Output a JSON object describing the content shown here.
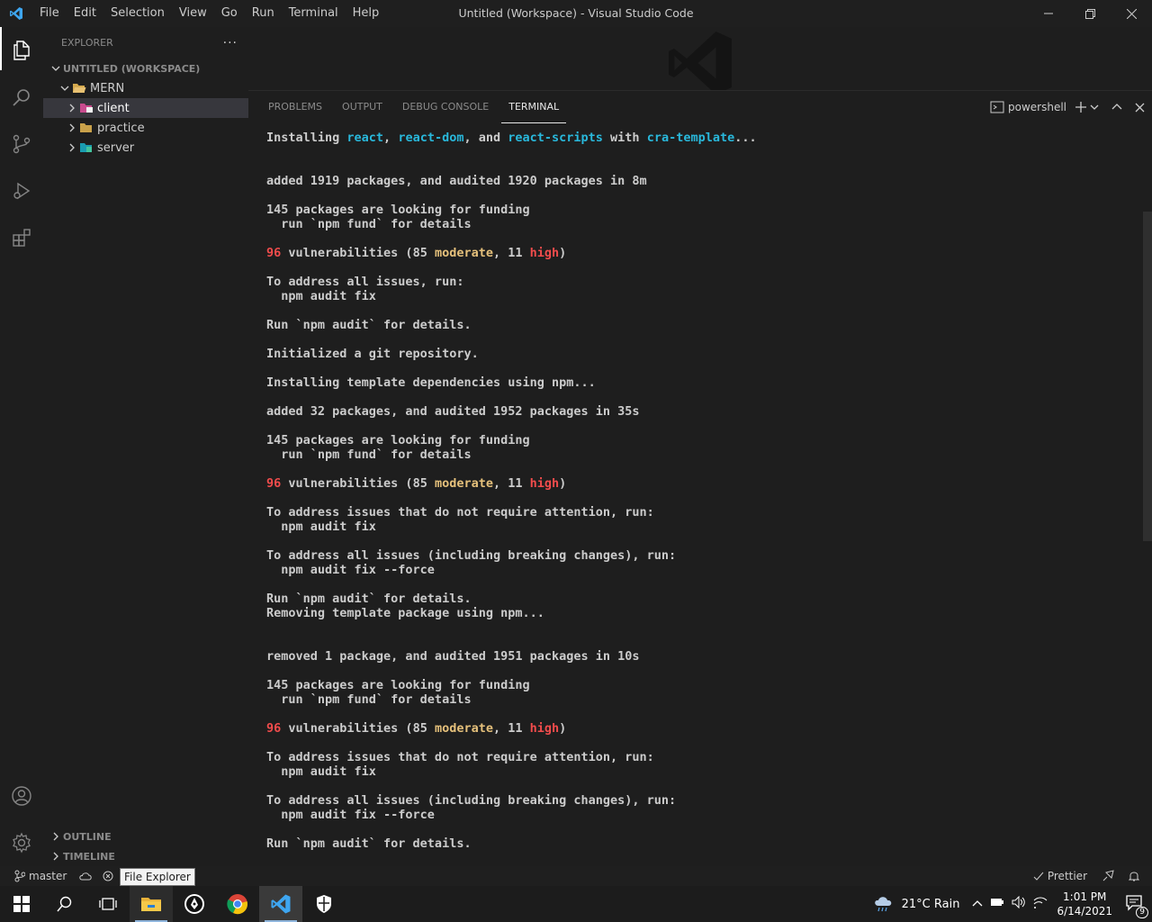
{
  "window": {
    "title": "Untitled (Workspace) - Visual Studio Code",
    "menu": [
      "File",
      "Edit",
      "Selection",
      "View",
      "Go",
      "Run",
      "Terminal",
      "Help"
    ]
  },
  "sidebar": {
    "header": "EXPLORER",
    "workspace": "UNTITLED (WORKSPACE)",
    "root_folder": "MERN",
    "folders": [
      {
        "name": "client",
        "selected": true,
        "icon": "folder-client-icon"
      },
      {
        "name": "practice",
        "selected": false,
        "icon": "folder-icon"
      },
      {
        "name": "server",
        "selected": false,
        "icon": "folder-server-icon"
      }
    ],
    "outline": "OUTLINE",
    "timeline": "TIMELINE"
  },
  "panel": {
    "tabs": [
      "PROBLEMS",
      "OUTPUT",
      "DEBUG CONSOLE",
      "TERMINAL"
    ],
    "active_tab": "TERMINAL",
    "shell": "powershell"
  },
  "terminal": {
    "l1_a": "Installing ",
    "l1_b": "react",
    "l1_c": ", ",
    "l1_d": "react-dom",
    "l1_e": ", and ",
    "l1_f": "react-scripts",
    "l1_g": " with ",
    "l1_h": "cra-template",
    "l1_i": "...",
    "l2": "added 1919 packages, and audited 1920 packages in 8m",
    "fund1": "145 packages are looking for funding",
    "fund2": "  run `npm fund` for details",
    "vuln_count": "96",
    "vuln_text": " vulnerabilities (85 ",
    "vuln_moderate": "moderate",
    "vuln_mid": ", 11 ",
    "vuln_high": "high",
    "vuln_end": ")",
    "addr_all": "To address all issues, run:",
    "fix": "  npm audit fix",
    "run_audit": "Run `npm audit` for details.",
    "git": "Initialized a git repository.",
    "template_deps": "Installing template dependencies using npm...",
    "added32": "added 32 packages, and audited 1952 packages in 35s",
    "addr_noattention": "To address issues that do not require attention, run:",
    "addr_breaking": "To address all issues (including breaking changes), run:",
    "fix_force": "  npm audit fix --force",
    "removing": "Removing template package using npm...",
    "removed": "removed 1 package, and audited 1951 packages in 10s"
  },
  "statusbar": {
    "branch": "master",
    "tooltip": "File Explorer",
    "prettier": "Prettier"
  },
  "taskbar": {
    "weather": "21°C  Rain",
    "time": "1:01 PM",
    "date": "6/14/2021",
    "notifications": "9"
  }
}
